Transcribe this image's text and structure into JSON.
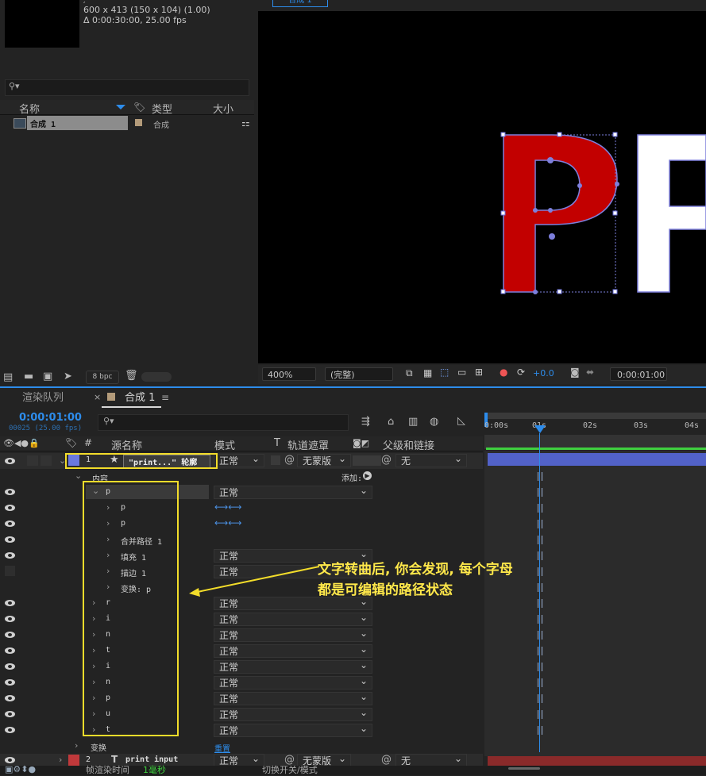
{
  "project": {
    "info_line1": "600 x 413  (150 x 104) (1.00)",
    "info_line2": "Δ 0:00:30:00, 25.00 fps",
    "search_placeholder": "",
    "col_name": "名称",
    "col_type": "类型",
    "col_size": "大小",
    "item_name": "合成 1",
    "item_type": "合成",
    "bpc": "8 bpc"
  },
  "viewer": {
    "tab": "合成 1",
    "zoom": "400%",
    "quality": "(完整)",
    "exposure": "+0.0",
    "timecode": "0:00:01:00",
    "letters_visible": [
      "P",
      "R"
    ]
  },
  "timeline": {
    "tab_render": "渲染队列",
    "tab_comp": "合成 1",
    "timecode": "0:00:01:00",
    "frame_info": "00025 (25.00 fps)",
    "col_source": "源名称",
    "col_mode": "模式",
    "col_t": "T",
    "col_matte": "轨道遮罩",
    "col_parent": "父级和链接",
    "col_hash": "#",
    "ruler_ticks": [
      "0:00s",
      "01s",
      "02s",
      "03s",
      "04s"
    ],
    "layer1": {
      "num": "1",
      "name": "\"print...\" 轮廓",
      "mode": "正常",
      "matte": "无蒙版",
      "parent": "无"
    },
    "content_label": "内容",
    "add_label": "添加:",
    "group_p": {
      "name": "p",
      "mode": "正常"
    },
    "sub_rows": [
      {
        "name": "p",
        "mode": ""
      },
      {
        "name": "p",
        "mode": ""
      },
      {
        "name": "合并路径 1",
        "mode": ""
      },
      {
        "name": "填充 1",
        "mode": "正常"
      },
      {
        "name": "描边 1",
        "mode": "正常"
      },
      {
        "name": "变换: p",
        "mode": ""
      }
    ],
    "letter_rows": [
      {
        "name": "r",
        "mode": "正常"
      },
      {
        "name": "i",
        "mode": "正常"
      },
      {
        "name": "n",
        "mode": "正常"
      },
      {
        "name": "t",
        "mode": "正常"
      },
      {
        "name": "i",
        "mode": "正常"
      },
      {
        "name": "n",
        "mode": "正常"
      },
      {
        "name": "p",
        "mode": "正常"
      },
      {
        "name": "u",
        "mode": "正常"
      },
      {
        "name": "t",
        "mode": "正常"
      }
    ],
    "transform_label": "变换",
    "reset_label": "重置",
    "layer2": {
      "num": "2",
      "name": "print input",
      "mode": "正常",
      "matte": "无蒙版",
      "parent": "无"
    },
    "bottom_left": "帧渲染时间",
    "bottom_value": "1毫秒",
    "bottom_mid": "切换开关/模式"
  },
  "annotation": {
    "line1": "文字转曲后, 你会发现, 每个字母",
    "line2": "都是可编辑的路径状态"
  },
  "colors": {
    "accent": "#2d8ceb",
    "highlight": "#f2dc2a",
    "letter_fill": "#c00000",
    "layer_label": "#6b79e0"
  }
}
